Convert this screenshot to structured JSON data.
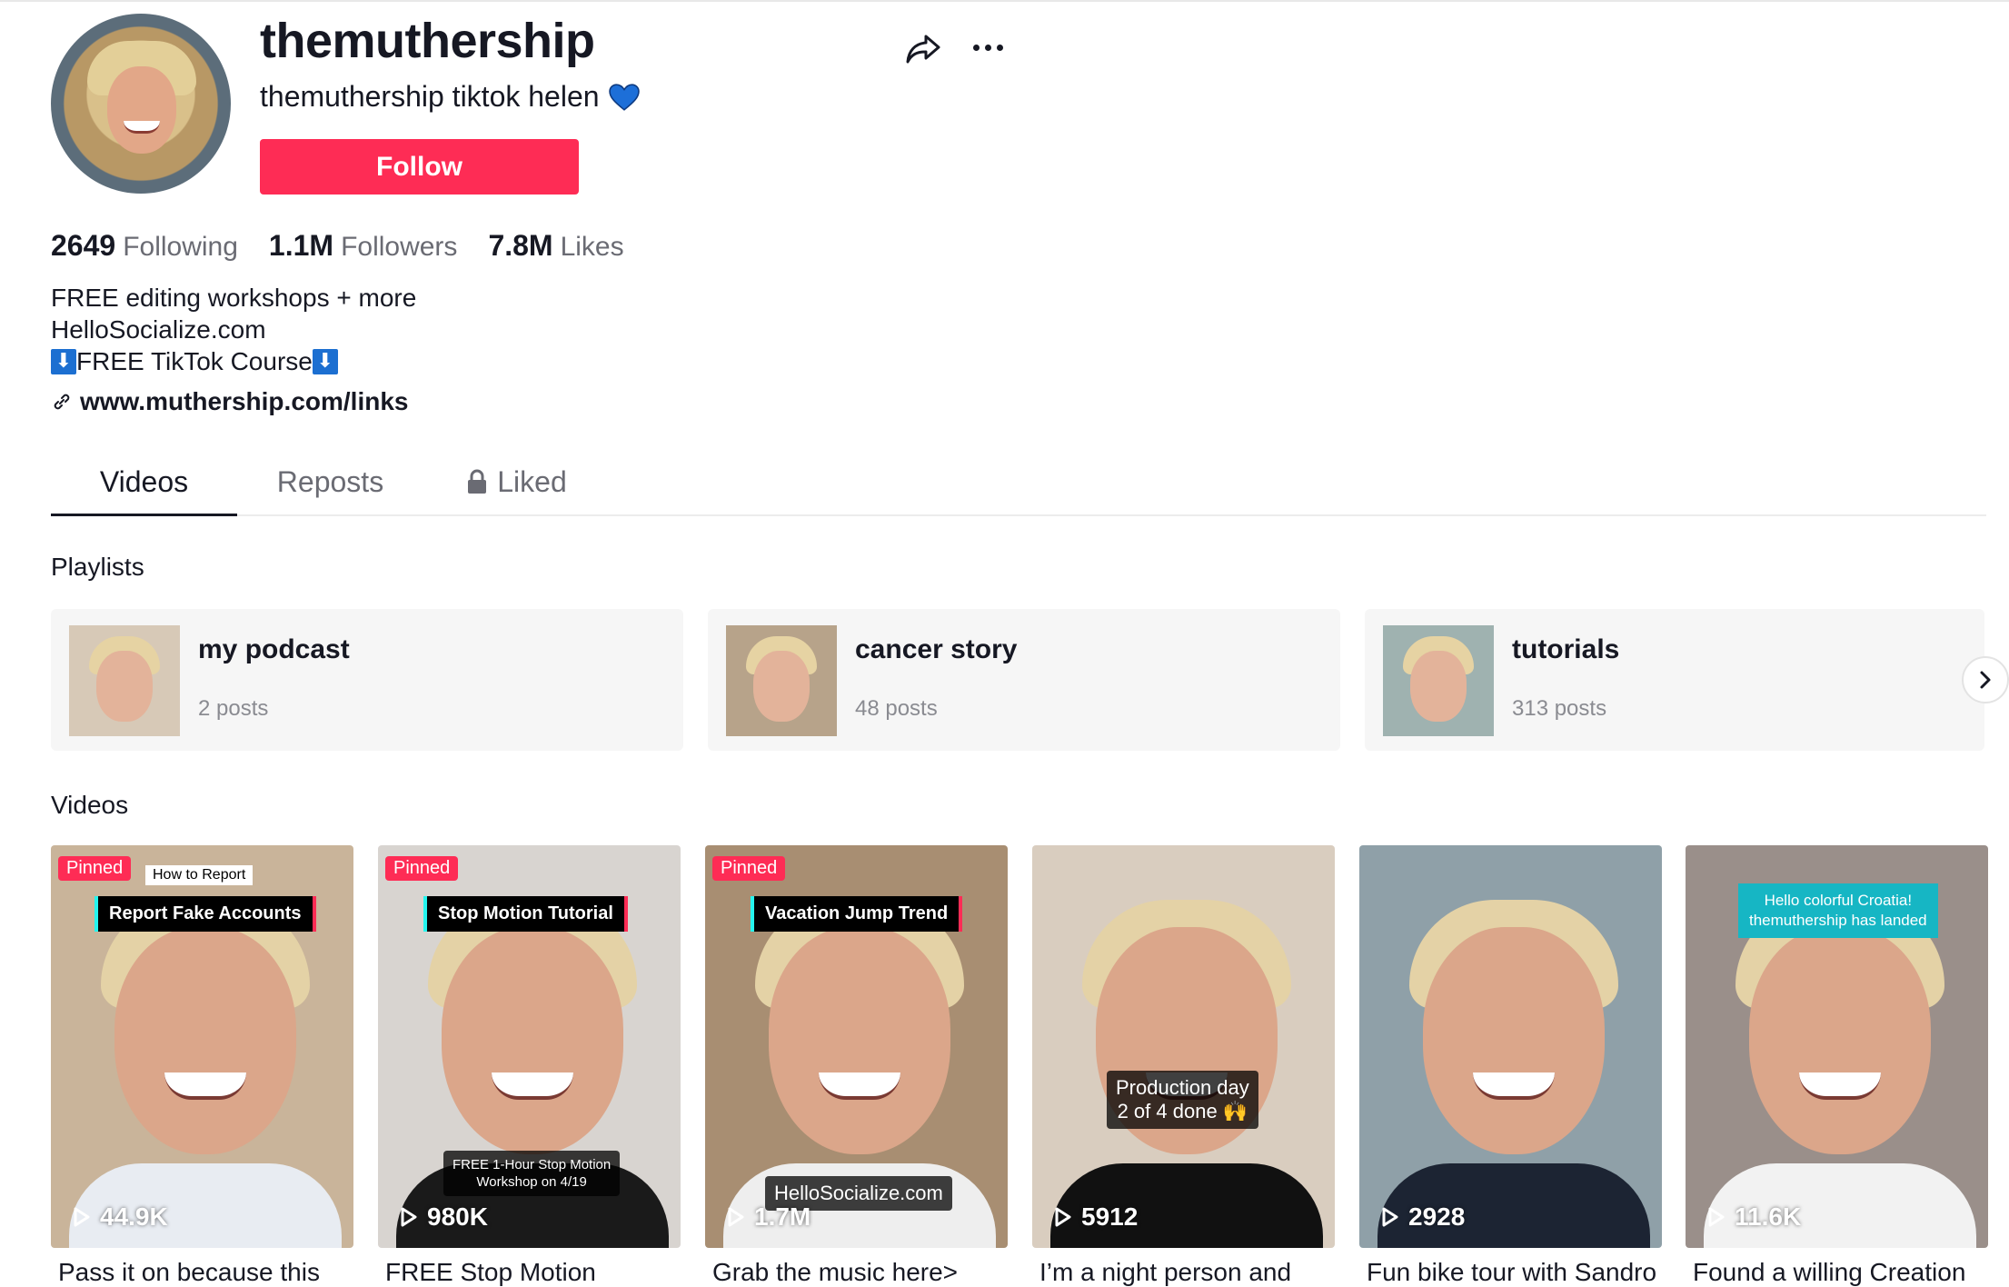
{
  "profile": {
    "username": "themuthership",
    "nickname": "themuthership tiktok helen",
    "follow_label": "Follow",
    "heart_color": "#1d6fd8"
  },
  "stats": {
    "following_count": "2649",
    "following_label": "Following",
    "followers_count": "1.1M",
    "followers_label": "Followers",
    "likes_count": "7.8M",
    "likes_label": "Likes"
  },
  "bio": {
    "line1": "FREE editing workshops + more",
    "line2": "HelloSocialize.com",
    "line3_text": "FREE TikTok Course",
    "arrow_glyph": "⬇",
    "link": "www.muthership.com/links"
  },
  "tabs": [
    {
      "label": "Videos",
      "active": true
    },
    {
      "label": "Reposts",
      "active": false
    },
    {
      "label": "Liked",
      "active": false,
      "icon": "lock-icon"
    }
  ],
  "sections": {
    "playlists_title": "Playlists",
    "videos_title": "Videos"
  },
  "playlists": [
    {
      "name": "my podcast",
      "posts": "2 posts"
    },
    {
      "name": "cancer story",
      "posts": "48 posts"
    },
    {
      "name": "tutorials",
      "posts": "313 posts"
    }
  ],
  "videos": [
    {
      "pinned": "Pinned",
      "tag": "How to Report",
      "caption": "Report Fake Accounts",
      "overlay": "",
      "views": "44.9K",
      "title": "Pass it on because this",
      "bg": "#c9b49a",
      "shirt": "#e8ecf2"
    },
    {
      "pinned": "Pinned",
      "tag": "",
      "caption": "Stop Motion Tutorial",
      "overlay": "FREE 1-Hour Stop Motion\nWorkshop on 4/19",
      "views": "980K",
      "title": "FREE Stop Motion",
      "bg": "#d8d4d0",
      "shirt": "#1a1a1a"
    },
    {
      "pinned": "Pinned",
      "tag": "",
      "caption": "Vacation Jump Trend",
      "overlay": "HelloSocialize.com",
      "views": "1.7M",
      "title": "Grab the music here>",
      "bg": "#a88e72",
      "shirt": "#eeeeee"
    },
    {
      "pinned": "",
      "tag": "",
      "caption": "",
      "overlay": "Production day\n2 of 4 done 🙌",
      "views": "5912",
      "title": "I’m a night person and",
      "bg": "#d9cdbf",
      "shirt": "#111111"
    },
    {
      "pinned": "",
      "tag": "",
      "caption": "",
      "overlay": "",
      "views": "2928",
      "title": "Fun bike tour with Sandro",
      "bg": "#8fa0a8",
      "shirt": "#1c2433"
    },
    {
      "pinned": "",
      "tag": "",
      "caption": "Hello colorful Croatia!\nthemuthership has landed",
      "overlay": "",
      "views": "11.6K",
      "title": "Found a willing Creation",
      "bg": "#9a8f8a",
      "shirt": "#f2f2f2"
    }
  ]
}
